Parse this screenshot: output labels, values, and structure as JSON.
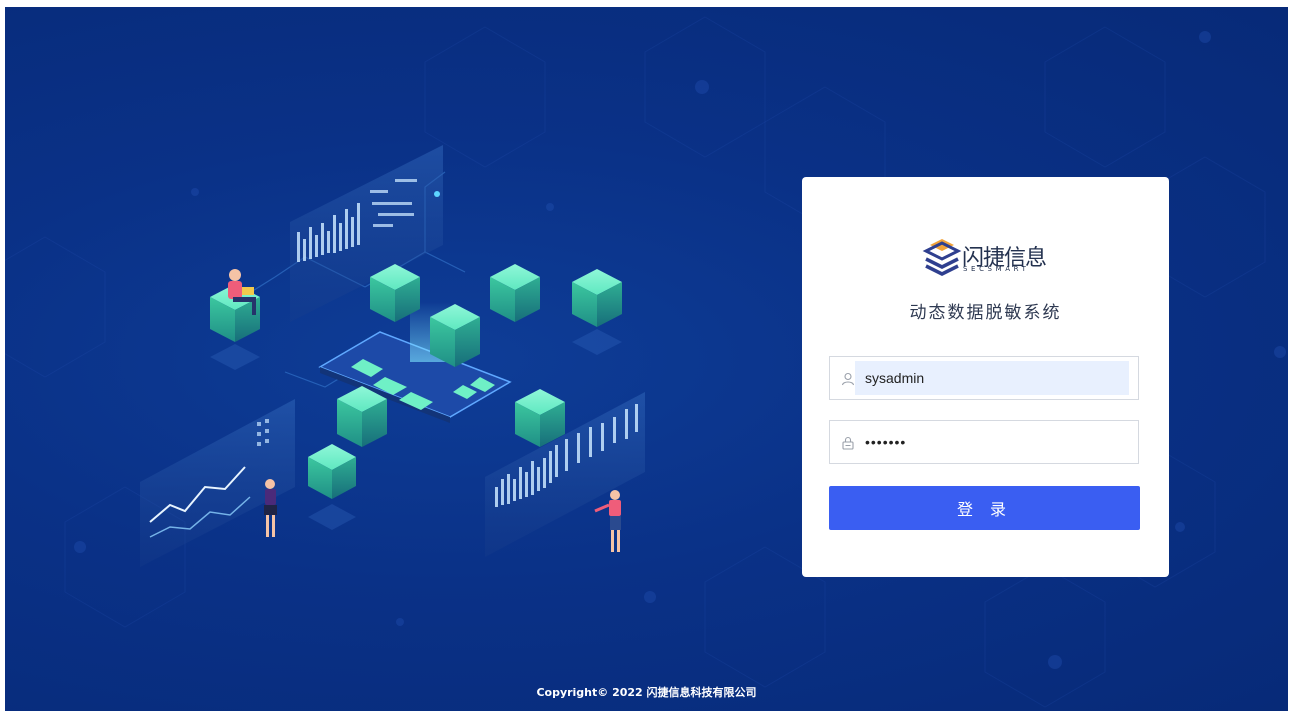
{
  "brand": {
    "name": "闪捷信息",
    "subname": "SECSMART",
    "colors": {
      "logo_orange": "#f2a33a",
      "logo_navy": "#2f3f8f"
    }
  },
  "system_title": "动态数据脱敏系统",
  "login_form": {
    "username_value": "sysadmin",
    "password_value": "•••••••",
    "submit_label": "登 录",
    "username_icon": "user-icon",
    "password_icon": "lock-icon"
  },
  "footer": {
    "copyright": "Copyright© 2022 闪捷信息科技有限公司"
  },
  "colors": {
    "background": "#0a3187",
    "accent_button": "#3a5ef2",
    "cube_green": "#49e2b2",
    "autofill_bg": "#e8f0fe"
  }
}
